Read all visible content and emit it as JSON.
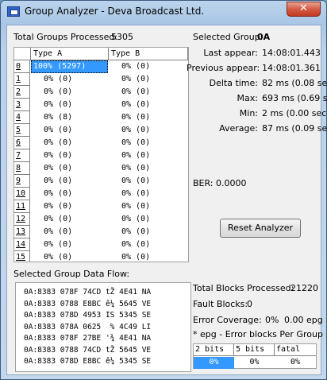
{
  "window": {
    "title": "Group Analyzer - Deva Broadcast Ltd.",
    "close_glyph": "✕"
  },
  "total_groups": {
    "label": "Total Groups Processed:",
    "value": "5305"
  },
  "selected_group": {
    "label": "Selected Group:",
    "value": "0A"
  },
  "stats": [
    {
      "label": "Last appear:",
      "value": "14:08:01.443"
    },
    {
      "label": "Previous appear:",
      "value": "14:08:01.361"
    },
    {
      "label": "Delta time:",
      "value": "82 ms (0.08 sec)"
    },
    {
      "label": "Max:",
      "value": "693 ms (0.69 sec)"
    },
    {
      "label": "Min:",
      "value": "2 ms (0.00 sec)"
    },
    {
      "label": "Average:",
      "value": "87 ms (0.09 sec)"
    }
  ],
  "ber": "BER: 0.0000",
  "reset_button": "Reset Analyzer",
  "grid": {
    "headers": [
      "Type A",
      "Type B"
    ],
    "rows": [
      {
        "n": "0",
        "a": "100% (5297)",
        "b": "0% (0)"
      },
      {
        "n": "1",
        "a": "0% (0)",
        "b": "0% (0)"
      },
      {
        "n": "2",
        "a": "0% (0)",
        "b": "0% (0)"
      },
      {
        "n": "3",
        "a": "0% (0)",
        "b": "0% (0)"
      },
      {
        "n": "4",
        "a": "0% (8)",
        "b": "0% (0)"
      },
      {
        "n": "5",
        "a": "0% (0)",
        "b": "0% (0)"
      },
      {
        "n": "6",
        "a": "0% (0)",
        "b": "0% (0)"
      },
      {
        "n": "7",
        "a": "0% (0)",
        "b": "0% (0)"
      },
      {
        "n": "8",
        "a": "0% (0)",
        "b": "0% (0)"
      },
      {
        "n": "9",
        "a": "0% (0)",
        "b": "0% (0)"
      },
      {
        "n": "10",
        "a": "0% (0)",
        "b": "0% (0)"
      },
      {
        "n": "11",
        "a": "0% (0)",
        "b": "0% (0)"
      },
      {
        "n": "12",
        "a": "0% (0)",
        "b": "0% (0)"
      },
      {
        "n": "13",
        "a": "0% (0)",
        "b": "0% (0)"
      },
      {
        "n": "14",
        "a": "0% (0)",
        "b": "0% (0)"
      },
      {
        "n": "15",
        "a": "0% (0)",
        "b": "0% (0)"
      }
    ]
  },
  "data_flow": {
    "label": "Selected Group Data Flow:",
    "lines": [
      "0A:8383 078F 74CD tŽ 4E41 NA",
      "0A:8383 0788 E8BC ê¼ 5645 VE",
      "0A:8383 078D 4953 IS 5345 SE",
      "0A:8383 078A 0625  % 4C49 LI",
      "0A:8383 078F 27BE '¾ 4E41 NA",
      "0A:8383 0788 74CD tŽ 5645 VE",
      "0A:8383 078D E8BC ê¼ 5345 SE"
    ]
  },
  "blocks": {
    "total_label": "Total Blocks Processed:",
    "total_value": "21220",
    "fault_label": "Fault Blocks:",
    "fault_value": "0",
    "coverage_label": "Error Coverage:",
    "coverage_pct": "0%",
    "coverage_epg": "0.00 epg",
    "note": "* epg - Error blocks Per Group",
    "bit_headers": [
      "2 bits",
      "5 bits",
      "fatal"
    ],
    "bit_values": [
      "0%",
      "0%",
      "0%"
    ]
  },
  "colors": {
    "selection": "#3399ff",
    "close": "#c23a22"
  }
}
